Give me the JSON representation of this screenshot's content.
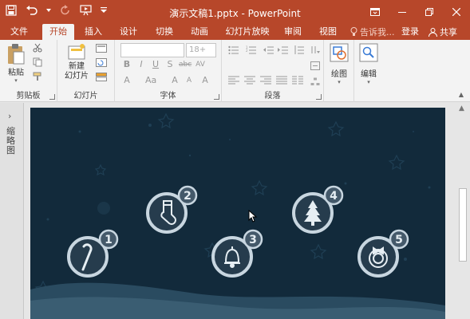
{
  "window": {
    "title": "演示文稿1.pptx - PowerPoint",
    "accent": "#b7472a"
  },
  "quick_access": [
    {
      "name": "save-icon"
    },
    {
      "name": "undo-icon"
    },
    {
      "name": "redo-icon"
    },
    {
      "name": "start-from-beginning-icon"
    },
    {
      "name": "customize-qat-icon"
    }
  ],
  "tabs": [
    "文件",
    "开始",
    "插入",
    "设计",
    "切换",
    "动画",
    "幻灯片放映",
    "审阅",
    "视图"
  ],
  "active_tab": "开始",
  "tell_me": "告诉我...",
  "login": "登录",
  "share": "共享",
  "ribbon": {
    "clipboard": {
      "paste": "粘贴",
      "label": "剪贴板"
    },
    "slides": {
      "new_slide": "新建\n幻灯片",
      "label": "幻灯片"
    },
    "font": {
      "font_name": "",
      "font_size": "18+",
      "label": "字体"
    },
    "paragraph": {
      "label": "段落"
    },
    "drawing": {
      "label": "绘图"
    },
    "editing": {
      "label": "编辑"
    }
  },
  "thumbnails_label": "缩略图",
  "slide": {
    "background": "#122a3b",
    "items": [
      {
        "number": "1",
        "icon": "candy-cane-icon"
      },
      {
        "number": "2",
        "icon": "stocking-icon"
      },
      {
        "number": "3",
        "icon": "bell-icon"
      },
      {
        "number": "4",
        "icon": "christmas-tree-icon"
      },
      {
        "number": "5",
        "icon": "wreath-icon"
      }
    ]
  }
}
